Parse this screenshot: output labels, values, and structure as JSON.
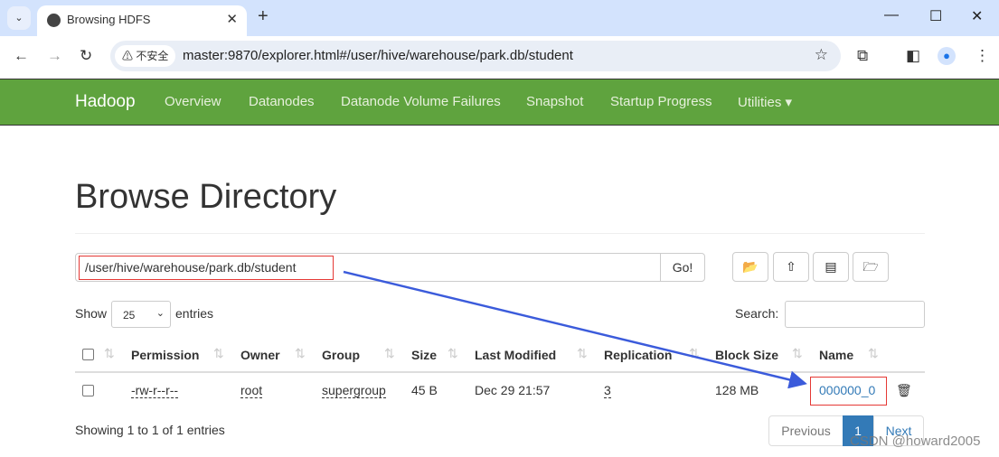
{
  "browser": {
    "tab_title": "Browsing HDFS",
    "security_label": "不安全",
    "url": "master:9870/explorer.html#/user/hive/warehouse/park.db/student"
  },
  "navbar": {
    "brand": "Hadoop",
    "items": [
      "Overview",
      "Datanodes",
      "Datanode Volume Failures",
      "Snapshot",
      "Startup Progress",
      "Utilities ▾"
    ],
    "color": "#5fa33e"
  },
  "page": {
    "title": "Browse Directory",
    "path_value": "/user/hive/warehouse/park.db/student",
    "go_label": "Go!",
    "show_label": "Show",
    "entries_select": "25",
    "entries_label": "entries",
    "search_label": "Search:",
    "search_value": ""
  },
  "table": {
    "headers": [
      "Permission",
      "Owner",
      "Group",
      "Size",
      "Last Modified",
      "Replication",
      "Block Size",
      "Name"
    ],
    "rows": [
      {
        "permission": "-rw-r--r--",
        "owner": "root",
        "group": "supergroup",
        "size": "45 B",
        "modified": "Dec 29 21:57",
        "replication": "3",
        "block_size": "128 MB",
        "name": "000000_0"
      }
    ]
  },
  "footer": {
    "info": "Showing 1 to 1 of 1 entries",
    "previous": "Previous",
    "page": "1",
    "next": "Next"
  },
  "watermark": "CSDN @howard2005",
  "annotation_color": "#3b5bdb"
}
